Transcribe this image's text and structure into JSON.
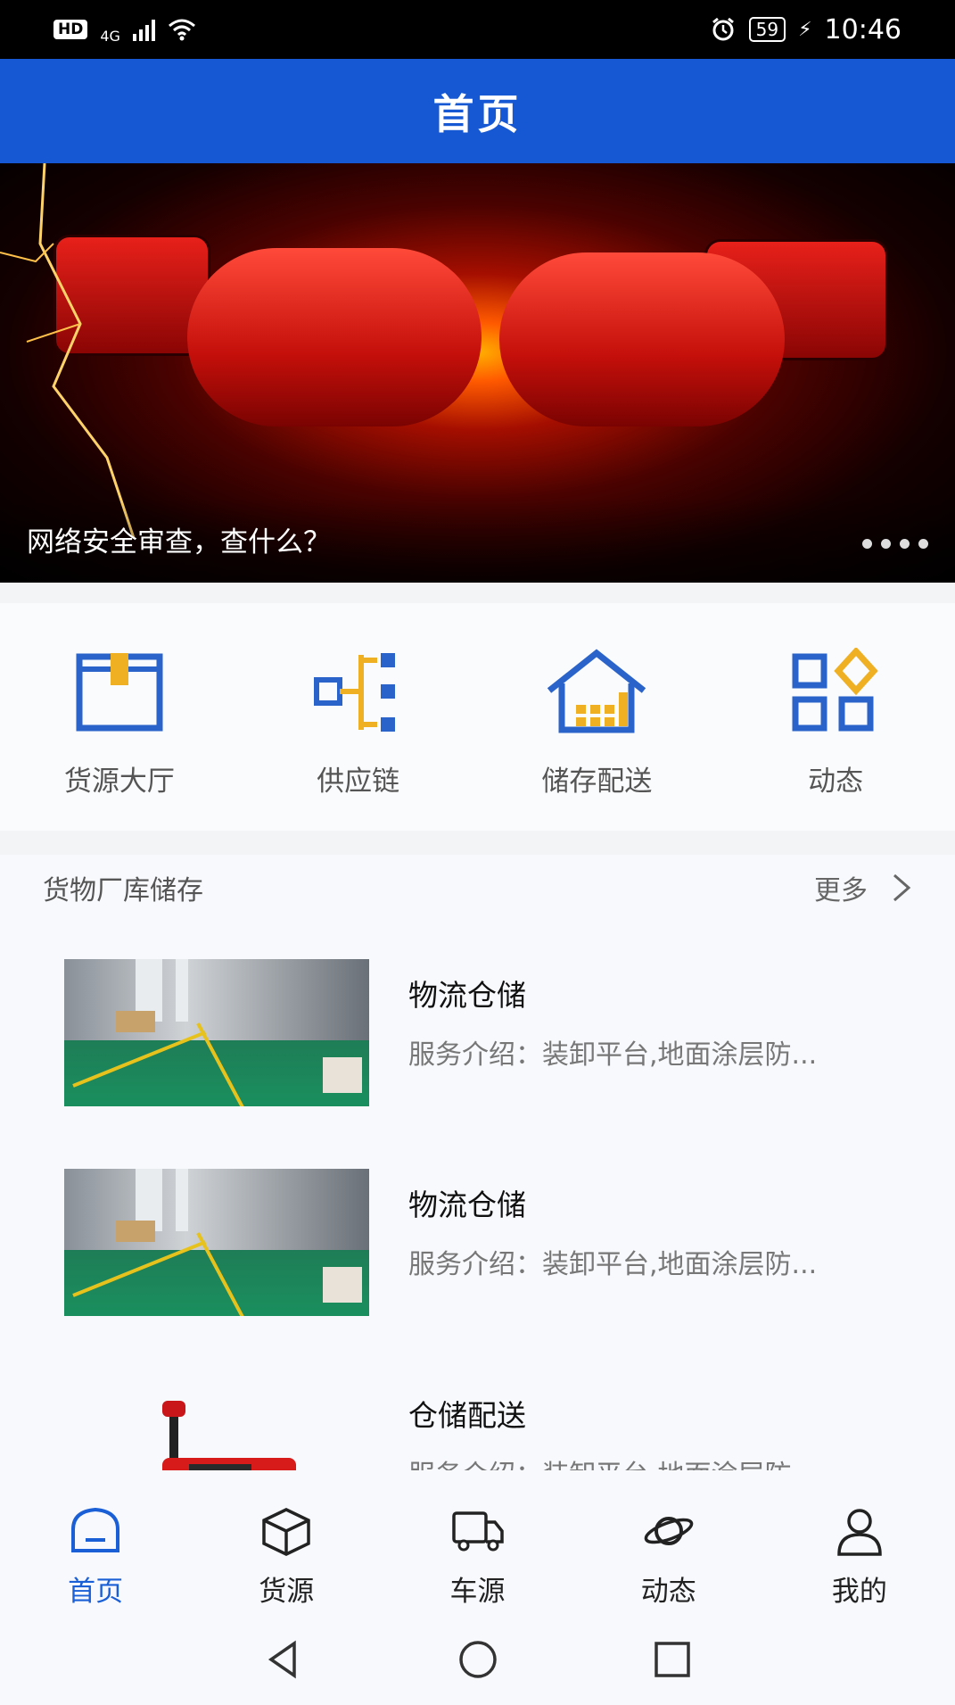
{
  "status_bar": {
    "hd": "HD",
    "network": "4G",
    "battery": "59",
    "time": "10:46",
    "icons": [
      "signal-icon",
      "wifi-icon",
      "alarm-icon",
      "battery-icon",
      "charging-icon"
    ]
  },
  "header": {
    "title": "首页"
  },
  "banner": {
    "caption": "网络安全审查，查什么？",
    "dots": 4
  },
  "shortcuts": [
    {
      "label": "货源大厅",
      "icon": "cargo-box-icon"
    },
    {
      "label": "供应链",
      "icon": "supply-chain-icon"
    },
    {
      "label": "储存配送",
      "icon": "warehouse-house-icon"
    },
    {
      "label": "动态",
      "icon": "grid-apps-icon"
    }
  ],
  "list": {
    "title": "货物厂库储存",
    "more": "更多",
    "items": [
      {
        "title": "物流仓储",
        "desc": "服务介绍：装卸平台,地面涂层防...",
        "image": "warehouse-photo"
      },
      {
        "title": "物流仓储",
        "desc": "服务介绍：装卸平台,地面涂层防...",
        "image": "warehouse-photo"
      },
      {
        "title": "仓储配送",
        "desc": "服务介绍：装卸平台,地面涂层防...",
        "image": "forklift-photo"
      }
    ]
  },
  "tabs": [
    {
      "label": "首页",
      "icon": "home-icon",
      "active": true
    },
    {
      "label": "货源",
      "icon": "cube-icon",
      "active": false
    },
    {
      "label": "车源",
      "icon": "truck-icon",
      "active": false
    },
    {
      "label": "动态",
      "icon": "planet-icon",
      "active": false
    },
    {
      "label": "我的",
      "icon": "user-icon",
      "active": false
    }
  ],
  "colors": {
    "primary": "#1657d3",
    "accent": "#f0b024",
    "icon_blue": "#2a63c9"
  }
}
